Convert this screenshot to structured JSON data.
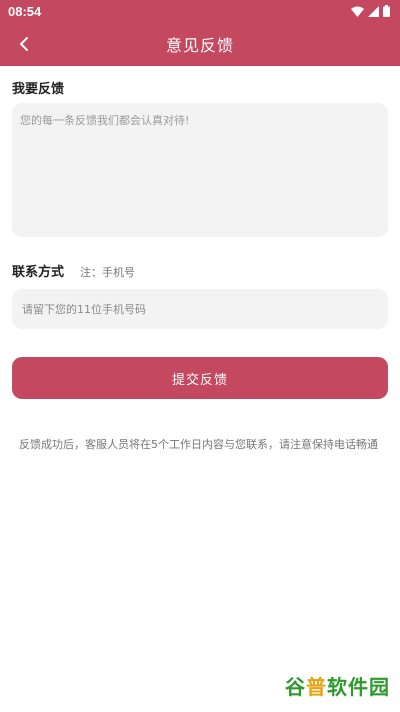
{
  "status_bar": {
    "time": "08:54",
    "icons": [
      "wifi-icon",
      "signal-icon",
      "battery-icon"
    ]
  },
  "header": {
    "title": "意见反馈",
    "back_icon": "back-arrow-icon"
  },
  "feedback": {
    "section_title": "我要反馈",
    "placeholder": "您的每一条反馈我们都会认真对待!"
  },
  "contact": {
    "label": "联系方式",
    "note": "注：手机号",
    "placeholder": "请留下您的11位手机号码"
  },
  "submit_button": "提交反馈",
  "notice": "反馈成功后，客服人员将在5个工作日内容与您联系，请注意保持电话畅通",
  "watermark": {
    "part1": "谷",
    "part2": "普",
    "part3": "软件园"
  },
  "colors": {
    "accent": "#c4485f",
    "input_bg": "#f3f3f3"
  }
}
